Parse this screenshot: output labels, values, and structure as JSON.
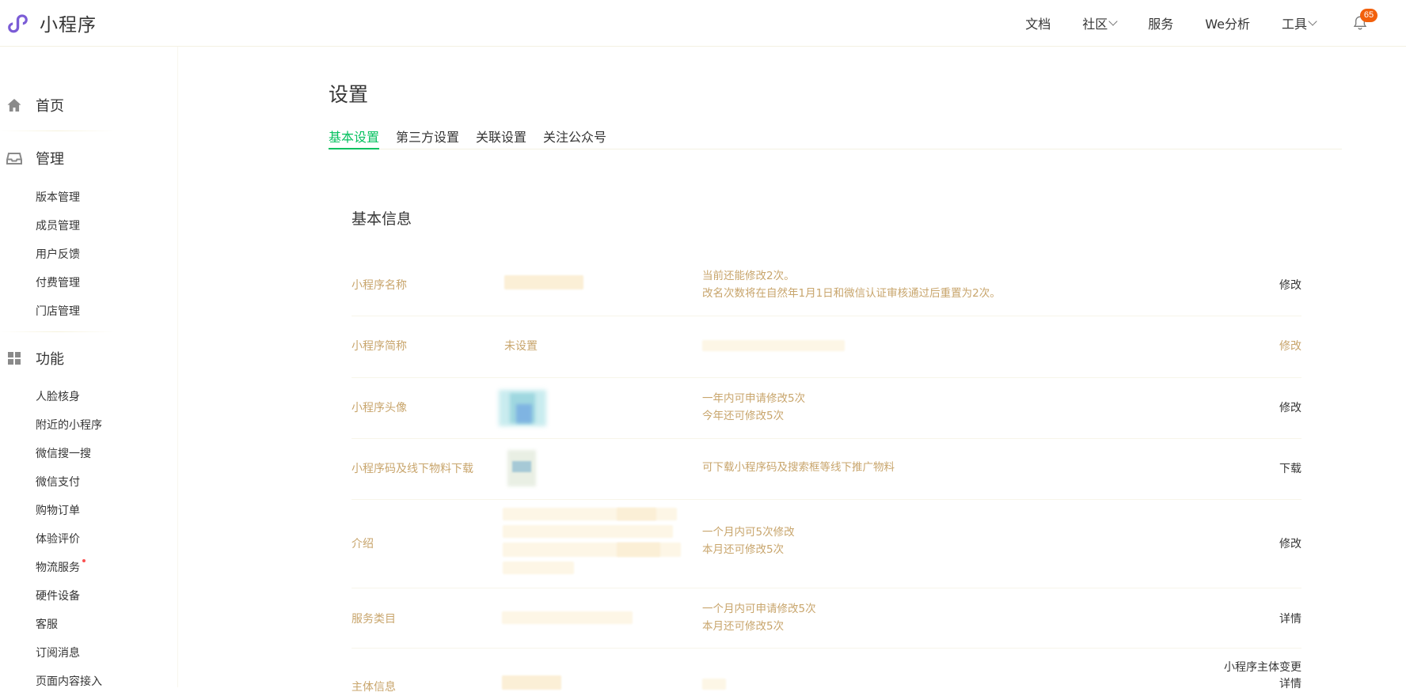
{
  "header": {
    "app_title": "小程序",
    "nav": [
      {
        "label": "文档",
        "dropdown": false
      },
      {
        "label": "社区",
        "dropdown": true
      },
      {
        "label": "服务",
        "dropdown": false
      },
      {
        "label": "We分析",
        "dropdown": false
      },
      {
        "label": "工具",
        "dropdown": true
      }
    ],
    "notification_count": "65",
    "brand_color": "#7b5cd6",
    "badge_color": "#f2600c"
  },
  "sidebar": {
    "home": "首页",
    "manage": "管理",
    "manage_items": [
      "版本管理",
      "成员管理",
      "用户反馈",
      "付费管理",
      "门店管理"
    ],
    "features": "功能",
    "feature_items": [
      "人脸核身",
      "附近的小程序",
      "微信搜一搜",
      "微信支付",
      "购物订单",
      "体验评价",
      "物流服务",
      "硬件设备",
      "客服",
      "订阅消息",
      "页面内容接入"
    ]
  },
  "main": {
    "title": "设置",
    "tabs": [
      "基本设置",
      "第三方设置",
      "关联设置",
      "关注公众号"
    ],
    "active_tab": "基本设置",
    "accent_color": "#07c160",
    "section_title": "基本信息",
    "rows": [
      {
        "label": "小程序名称",
        "value": "",
        "tips": [
          "当前还能修改2次。",
          "改名次数将在自然年1月1日和微信认证审核通过后重置为2次。"
        ],
        "action": "修改"
      },
      {
        "label": "小程序简称",
        "value": "未设置",
        "tips": [],
        "action": "修改"
      },
      {
        "label": "小程序头像",
        "value": "",
        "tips": [
          "一年内可申请修改5次",
          "今年还可修改5次"
        ],
        "action": "修改"
      },
      {
        "label": "小程序码及线下物料下载",
        "value": "",
        "tips": [
          "可下载小程序码及搜索框等线下推广物料"
        ],
        "action": "下载"
      },
      {
        "label": "介绍",
        "value": "",
        "tips": [
          "一个月内可5次修改",
          "本月还可修改5次"
        ],
        "action": "修改"
      },
      {
        "label": "服务类目",
        "value": "",
        "tips": [
          "一个月内可申请修改5次",
          "本月还可修改5次"
        ],
        "action": "详情"
      },
      {
        "label": "主体信息",
        "value": "",
        "tips": [],
        "action": [
          "小程序主体变更",
          "详情"
        ]
      }
    ]
  }
}
